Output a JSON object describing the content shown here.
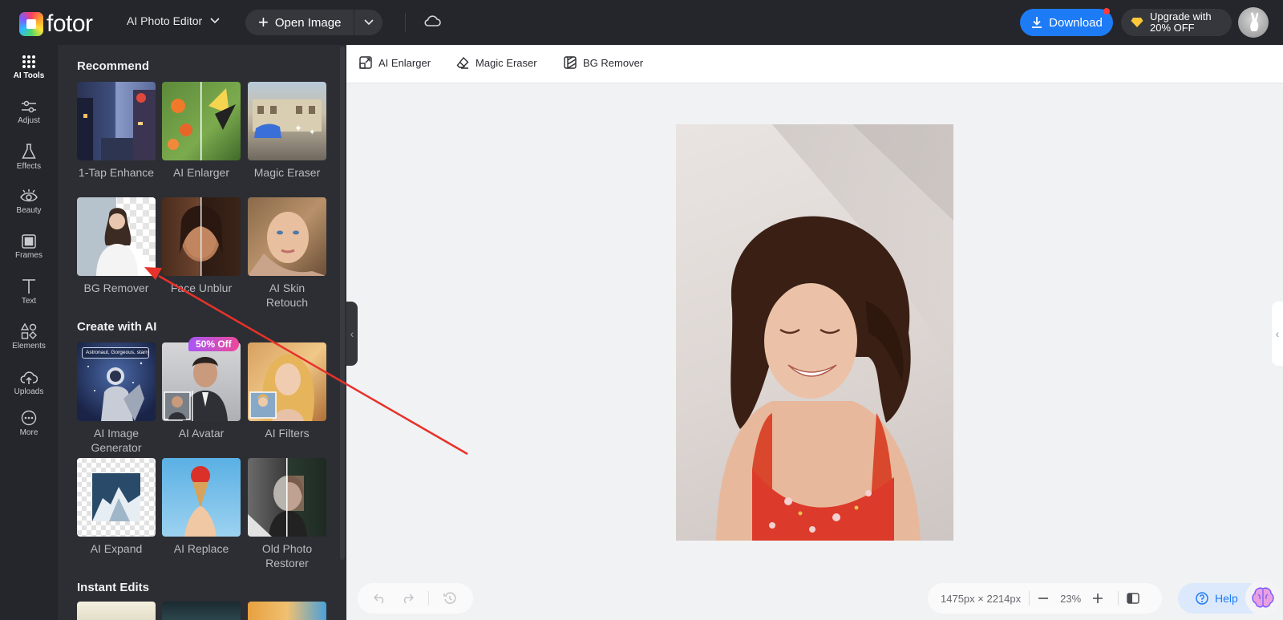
{
  "header": {
    "logo_text": "fotor",
    "editor_mode": "AI Photo Editor",
    "open_image": "Open Image",
    "download": "Download",
    "upgrade_line1": "Upgrade with",
    "upgrade_line2": "20% OFF"
  },
  "rail": {
    "items": [
      {
        "label": "AI Tools",
        "icon": "grid-icon"
      },
      {
        "label": "Adjust",
        "icon": "sliders-icon"
      },
      {
        "label": "Effects",
        "icon": "flask-icon"
      },
      {
        "label": "Beauty",
        "icon": "eye-icon"
      },
      {
        "label": "Frames",
        "icon": "frame-icon"
      },
      {
        "label": "Text",
        "icon": "text-icon"
      },
      {
        "label": "Elements",
        "icon": "shapes-icon"
      },
      {
        "label": "Uploads",
        "icon": "upload-cloud-icon"
      },
      {
        "label": "More",
        "icon": "more-icon"
      }
    ]
  },
  "panel": {
    "sections": [
      {
        "title": "Recommend"
      },
      {
        "title": "Create with AI"
      },
      {
        "title": "Instant Edits"
      }
    ],
    "tools": [
      {
        "label": "1-Tap Enhance"
      },
      {
        "label": "AI Enlarger"
      },
      {
        "label": "Magic Eraser"
      },
      {
        "label": "BG Remover"
      },
      {
        "label": "Face Unblur"
      },
      {
        "label": "AI Skin Retouch"
      },
      {
        "label": "AI Image Generator",
        "thumb_text": "Astronaut, Gorgeous, starry"
      },
      {
        "label": "AI Avatar",
        "badge": "50% Off"
      },
      {
        "label": "AI Filters"
      },
      {
        "label": "AI Expand"
      },
      {
        "label": "AI Replace"
      },
      {
        "label": "Old Photo Restorer"
      }
    ]
  },
  "toolbar2": {
    "items": [
      {
        "label": "AI Enlarger",
        "icon": "enlarge-icon"
      },
      {
        "label": "Magic Eraser",
        "icon": "eraser-icon"
      },
      {
        "label": "BG Remover",
        "icon": "bg-remove-icon"
      }
    ]
  },
  "footer": {
    "dimensions": "1475px × 2214px",
    "zoom": "23%",
    "help": "Help"
  },
  "colors": {
    "accent": "#1e7bf6",
    "topbar": "#24262b",
    "panel": "#2c2e33",
    "badge_start": "#a855f7",
    "badge_end": "#ec4899",
    "annotation_arrow": "#e8322a"
  }
}
